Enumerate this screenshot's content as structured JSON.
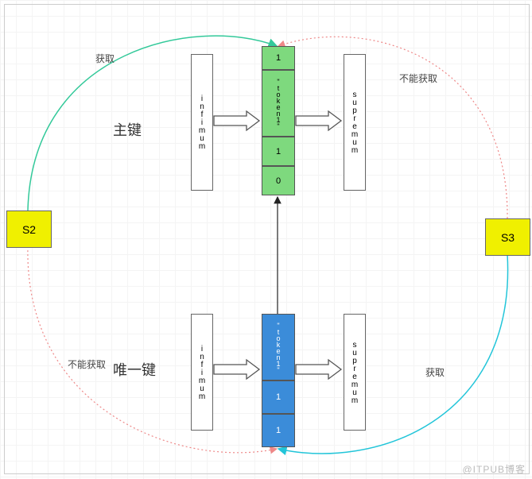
{
  "sessions": {
    "left": "S2",
    "right": "S3"
  },
  "labels": {
    "primary": "主键",
    "unique": "唯一键"
  },
  "annotations": {
    "get": "获取",
    "cannot": "不能获取"
  },
  "columns": {
    "infimum": "infimum",
    "supremum": "supremum"
  },
  "pk": {
    "c1": "1",
    "token": "\"token1\"",
    "c3": "1",
    "c4": "0"
  },
  "uk": {
    "token": "\"token1\"",
    "c2": "1",
    "c3": "1"
  },
  "watermark": "@ITPUB博客"
}
